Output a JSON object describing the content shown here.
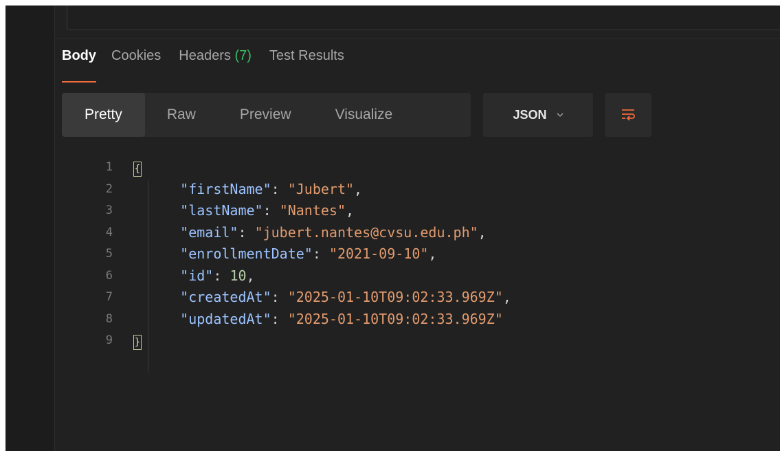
{
  "response_tabs": [
    {
      "label": "Body",
      "count": "",
      "active": true
    },
    {
      "label": "Cookies",
      "count": "",
      "active": false
    },
    {
      "label": "Headers",
      "count": "(7)",
      "active": false
    },
    {
      "label": "Test Results",
      "count": "",
      "active": false
    }
  ],
  "view_modes": [
    "Pretty",
    "Raw",
    "Preview",
    "Visualize"
  ],
  "format_select": {
    "value": "JSON"
  },
  "icons": {
    "dropdown": "chevron-down-icon",
    "wrap": "wrap-lines-icon"
  },
  "colors": {
    "accent": "#f26b3a",
    "count": "#3ebd63",
    "key": "#9cc3ff",
    "string": "#e29b6e",
    "number": "#b5cea8"
  },
  "code_lines": [
    {
      "no": "1",
      "open": "{"
    },
    {
      "no": "2",
      "key": "\"firstName\"",
      "sep": ": ",
      "value": "\"Jubert\"",
      "vtype": "str",
      "trail": ","
    },
    {
      "no": "3",
      "key": "\"lastName\"",
      "sep": ": ",
      "value": "\"Nantes\"",
      "vtype": "str",
      "trail": ","
    },
    {
      "no": "4",
      "key": "\"email\"",
      "sep": ": ",
      "value": "\"jubert.nantes@cvsu.edu.ph\"",
      "vtype": "str",
      "trail": ","
    },
    {
      "no": "5",
      "key": "\"enrollmentDate\"",
      "sep": ": ",
      "value": "\"2021-09-10\"",
      "vtype": "str",
      "trail": ","
    },
    {
      "no": "6",
      "key": "\"id\"",
      "sep": ": ",
      "value": "10",
      "vtype": "num",
      "trail": ","
    },
    {
      "no": "7",
      "key": "\"createdAt\"",
      "sep": ": ",
      "value": "\"2025-01-10T09:02:33.969Z\"",
      "vtype": "str",
      "trail": ","
    },
    {
      "no": "8",
      "key": "\"updatedAt\"",
      "sep": ": ",
      "value": "\"2025-01-10T09:02:33.969Z\"",
      "vtype": "str",
      "trail": ""
    },
    {
      "no": "9",
      "open": "}"
    }
  ]
}
